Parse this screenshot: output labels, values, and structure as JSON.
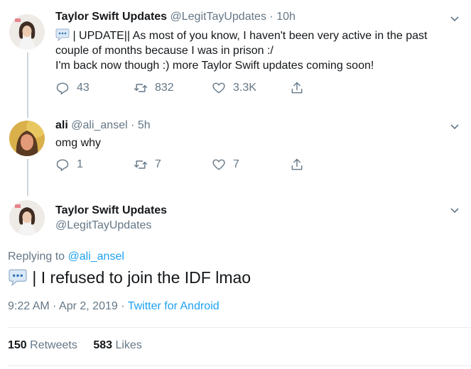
{
  "tweet1": {
    "name": "Taylor Swift Updates",
    "handle": "@LegitTayUpdates",
    "time": "10h",
    "line1": "| UPDATE|| As most of you know, I haven't been very active in the past",
    "line2": "couple of months because I was in prison :/",
    "line3": "I'm back now though :) more Taylor Swift updates coming soon!",
    "replies": "43",
    "retweets": "832",
    "likes": "3.3K"
  },
  "tweet2": {
    "name": "ali",
    "handle": "@ali_ansel",
    "time": "5h",
    "text": "omg why",
    "replies": "1",
    "retweets": "7",
    "likes": "7"
  },
  "main": {
    "name": "Taylor Swift Updates",
    "handle": "@LegitTayUpdates",
    "replying_prefix": "Replying to",
    "replying_to": "@ali_ansel",
    "text": "| I refused to join the IDF lmao",
    "timestamp": "9:22 AM · Apr 2, 2019 ·",
    "source": "Twitter for Android",
    "retweets_count": "150",
    "retweets_label": "Retweets",
    "likes_count": "583",
    "likes_label": "Likes"
  },
  "icons": {
    "reply": "reply-icon",
    "retweet": "retweet-icon",
    "like": "heart-icon",
    "share": "share-icon",
    "menu": "chevron-down-icon",
    "speech": "speech-balloon-icon"
  },
  "colors": {
    "accent": "#1da1f2",
    "muted": "#657786",
    "divider": "#e6ecf0"
  }
}
